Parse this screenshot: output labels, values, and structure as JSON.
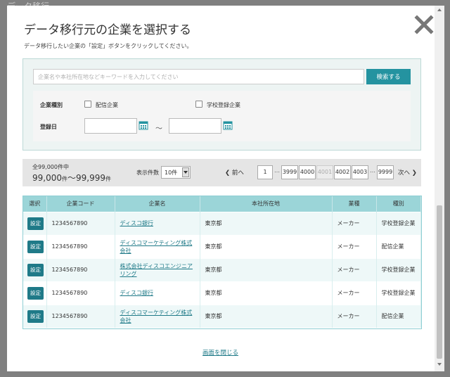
{
  "background": {
    "title": "データ移行"
  },
  "modal": {
    "title": "データ移行元の企業を選択する",
    "subtitle": "データ移行したい企業の「設定」ボタンをクリックしてください。",
    "close_icon": "close-x-icon"
  },
  "search": {
    "placeholder": "企業名や本社所在地などキーワードを入力してください",
    "value": "",
    "button_label": "検索する"
  },
  "filters": {
    "type_label": "企業種別",
    "type_options": [
      {
        "label": "配信企業",
        "checked": false
      },
      {
        "label": "学校登録企業",
        "checked": false
      }
    ],
    "date_label": "登録日",
    "date_from": "",
    "date_to": "",
    "date_separator": "～",
    "calendar_icon": "calendar-icon"
  },
  "pager": {
    "total_label": "全99,000件中",
    "range_from": "99,000",
    "range_unit": "件",
    "range_sep": "～",
    "range_to": "99,999",
    "per_page_label": "表示件数",
    "per_page_value": "10件",
    "prev_label": "前へ",
    "next_label": "次へ",
    "first_page": "1",
    "ellipsis": "…",
    "pages": [
      "3999",
      "4000",
      "4001",
      "4002",
      "4003"
    ],
    "current_page": "4001",
    "last_page": "9999"
  },
  "table": {
    "headers": [
      "選択",
      "企業コード",
      "企業名",
      "本社所在地",
      "業種",
      "種別"
    ],
    "select_label": "設定",
    "rows": [
      {
        "code": "1234567890",
        "name": "ディスコ銀行",
        "name2": "",
        "location": "東京都",
        "industry": "メーカー",
        "type": "学校登録企業"
      },
      {
        "code": "1234567890",
        "name": "ディスコマーケティング株式",
        "name2": "会社",
        "location": "東京都",
        "industry": "メーカー",
        "type": "配信企業"
      },
      {
        "code": "1234567890",
        "name": "株式会社ディスコエンジニア",
        "name2": "リング",
        "location": "東京都",
        "industry": "メーカー",
        "type": "学校登録企業"
      },
      {
        "code": "1234567890",
        "name": "ディスコ銀行",
        "name2": "",
        "location": "東京都",
        "industry": "メーカー",
        "type": "学校登録企業"
      },
      {
        "code": "1234567890",
        "name": "ディスコマーケティング株式",
        "name2": "会社",
        "location": "東京都",
        "industry": "メーカー",
        "type": "配信企業"
      }
    ]
  },
  "footer": {
    "close_label": "画面を閉じる"
  },
  "colors": {
    "accent": "#1f7a88",
    "header_bg": "#9bd5d8",
    "search_button": "#2493a0"
  }
}
